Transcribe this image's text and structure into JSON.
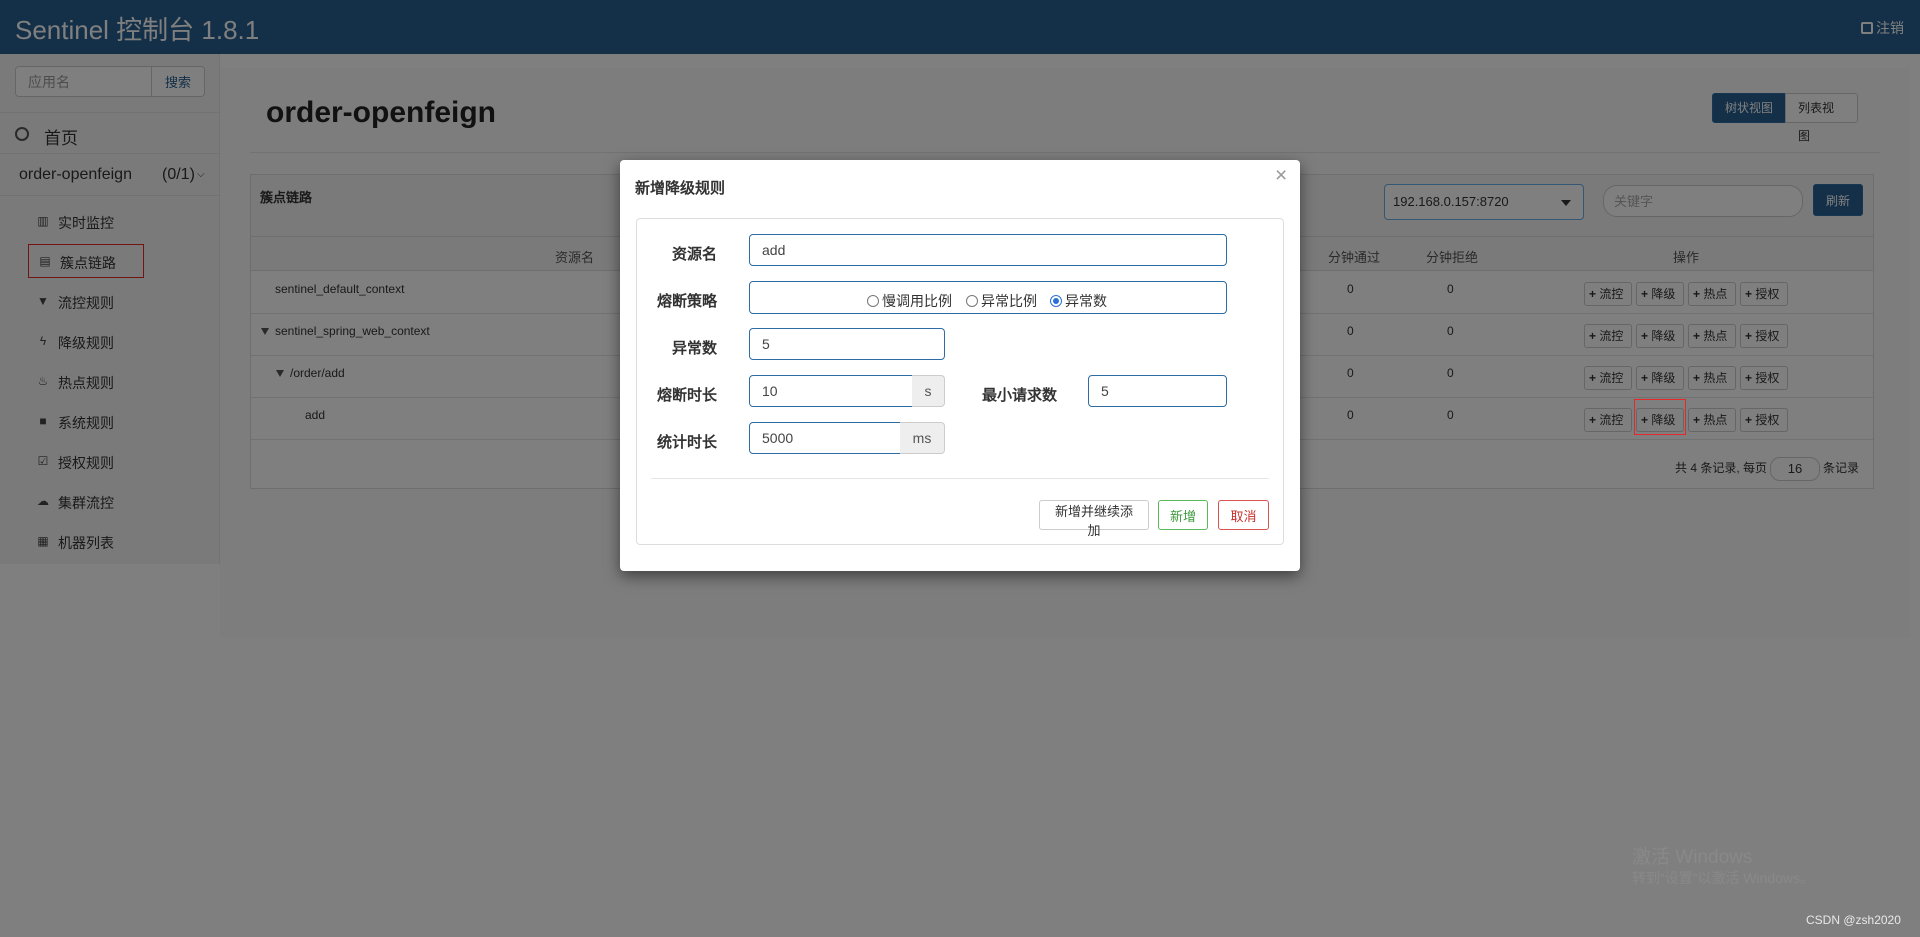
{
  "app": {
    "title": "Sentinel 控制台 1.8.1",
    "logout": "注销"
  },
  "sidebar": {
    "search_placeholder": "应用名",
    "search_button": "搜索",
    "home": "首页",
    "app_name": "order-openfeign",
    "app_count": "(0/1)",
    "items": [
      {
        "label": "实时监控",
        "icon": "bar-chart-icon"
      },
      {
        "label": "簇点链路",
        "icon": "list-icon"
      },
      {
        "label": "流控规则",
        "icon": "filter-icon"
      },
      {
        "label": "降级规则",
        "icon": "flash-icon"
      },
      {
        "label": "热点规则",
        "icon": "fire-icon"
      },
      {
        "label": "系统规则",
        "icon": "lock-icon"
      },
      {
        "label": "授权规则",
        "icon": "check-icon"
      },
      {
        "label": "集群流控",
        "icon": "cloud-icon"
      },
      {
        "label": "机器列表",
        "icon": "th-list-icon"
      }
    ]
  },
  "main": {
    "title": "order-openfeign",
    "view_tree": "树状视图",
    "view_list": "列表视图",
    "card_label": "簇点链路",
    "machine": "192.168.0.157:8720",
    "keyword_placeholder": "关键字",
    "refresh": "刷新",
    "columns": {
      "resource": "资源名",
      "pass": "分钟通过",
      "block": "分钟拒绝",
      "ops": "操作"
    },
    "rows": [
      {
        "name": "sentinel_default_context",
        "pass": "0",
        "block": "0"
      },
      {
        "name": "sentinel_spring_web_context",
        "pass": "0",
        "block": "0"
      },
      {
        "name": "/order/add",
        "pass": "0",
        "block": "0"
      },
      {
        "name": "add",
        "pass": "0",
        "block": "0"
      }
    ],
    "op_buttons": {
      "flow": "流控",
      "degrade": "降级",
      "hot": "热点",
      "auth": "授权"
    },
    "pager": {
      "prefix": "共 4 条记录, 每页",
      "page_size": "16",
      "suffix": "条记录"
    }
  },
  "modal": {
    "title": "新增降级规则",
    "close": "×",
    "resource_label": "资源名",
    "resource_value": "add",
    "strategy_label": "熔断策略",
    "strategy_options": [
      "慢调用比例",
      "异常比例",
      "异常数"
    ],
    "strategy_selected": 2,
    "exception_count_label": "异常数",
    "exception_count_value": "5",
    "duration_label": "熔断时长",
    "duration_value": "10",
    "duration_unit": "s",
    "min_request_label": "最小请求数",
    "min_request_value": "5",
    "stat_label": "统计时长",
    "stat_value": "5000",
    "stat_unit": "ms",
    "btn_add_continue": "新增并继续添加",
    "btn_add": "新增",
    "btn_cancel": "取消"
  },
  "watermark": {
    "line1": "激活 Windows",
    "line2": "转到“设置”以激活 Windows。",
    "credit": "CSDN @zsh2020"
  }
}
